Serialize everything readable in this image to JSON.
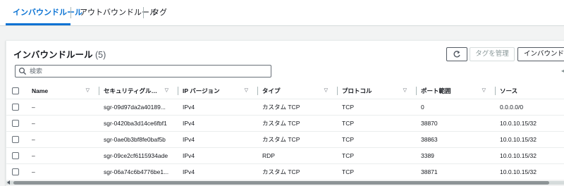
{
  "tabs": [
    {
      "label": "インバウンドルール",
      "active": true
    },
    {
      "label": "アウトバウンドルール",
      "active": false
    },
    {
      "label": "タグ",
      "active": false
    }
  ],
  "panel": {
    "title": "インバウンドルール",
    "count": "(5)",
    "refresh_icon": "refresh-icon",
    "manage_tags_label": "タグを管理",
    "edit_inbound_label": "インバウンドの"
  },
  "search": {
    "placeholder": "検索",
    "value": "",
    "icon": "search-icon"
  },
  "table": {
    "columns": [
      "Name",
      "セキュリティグループ...",
      "IP バージョン",
      "タイプ",
      "プロトコル",
      "ポート範囲",
      "ソース"
    ],
    "rows": [
      {
        "name": "–",
        "rule_id": "sgr-09d97da2a40189...",
        "ip_version": "IPv4",
        "type": "カスタム TCP",
        "protocol": "TCP",
        "port_range": "0",
        "source": "0.0.0.0/0"
      },
      {
        "name": "–",
        "rule_id": "sgr-0420ba3d14ce6fbf1",
        "ip_version": "IPv4",
        "type": "カスタム TCP",
        "protocol": "TCP",
        "port_range": "38870",
        "source": "10.0.10.15/32"
      },
      {
        "name": "–",
        "rule_id": "sgr-0ae0b3bf8fe0baf5b",
        "ip_version": "IPv4",
        "type": "カスタム TCP",
        "protocol": "TCP",
        "port_range": "38863",
        "source": "10.0.10.15/32"
      },
      {
        "name": "–",
        "rule_id": "sgr-09ce2cf6115934ade",
        "ip_version": "IPv4",
        "type": "RDP",
        "protocol": "TCP",
        "port_range": "3389",
        "source": "10.0.10.15/32"
      },
      {
        "name": "–",
        "rule_id": "sgr-06a74c6b4776be1...",
        "ip_version": "IPv4",
        "type": "カスタム TCP",
        "protocol": "TCP",
        "port_range": "38871",
        "source": "10.0.10.15/32"
      }
    ]
  },
  "colors": {
    "accent": "#0972d3",
    "border": "#eaeded",
    "background": "#f2f3f3"
  }
}
